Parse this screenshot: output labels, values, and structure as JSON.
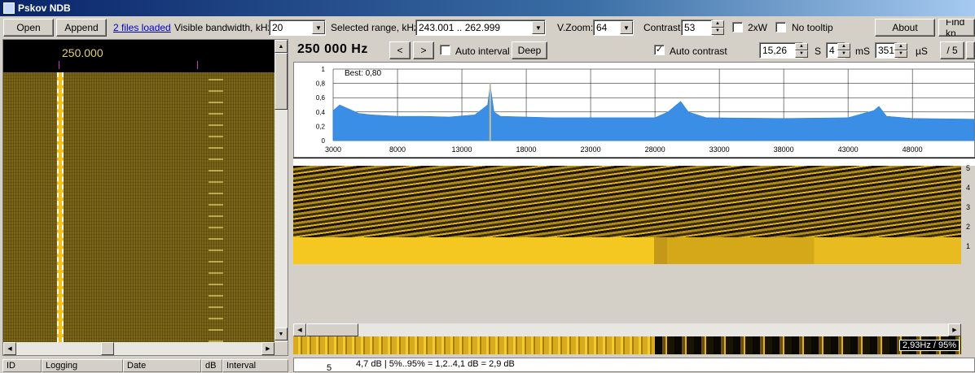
{
  "window": {
    "title": "Pskov NDB"
  },
  "toolbar": {
    "open_label": "Open",
    "append_label": "Append",
    "files_loaded": "2 files loaded",
    "visible_bw_label": "Visible bandwidth, kHz:",
    "visible_bw_value": "20",
    "selected_range_label": "Selected range, kHz:",
    "selected_range_value": "243.001 .. 262.999",
    "vzoom_label": "V.Zoom:",
    "vzoom_value": "64",
    "contrast_label": "Contrast:",
    "contrast_value": "53",
    "twoxw_label": "2xW",
    "no_tooltip_label": "No tooltip",
    "about_label": "About",
    "find_label": "Find kn"
  },
  "left_panel": {
    "center_freq": "250.000"
  },
  "table": {
    "columns": [
      "ID",
      "Logging",
      "Date",
      "dB",
      "Interval"
    ]
  },
  "right_panel": {
    "freq_display": "250 000 Hz",
    "prev_label": "<",
    "next_label": ">",
    "auto_interval_label": "Auto interval",
    "deep_label": "Deep",
    "auto_contrast_label": "Auto contrast",
    "auto_contrast_checked": true,
    "s_value": "15,26",
    "s_unit": "S",
    "ms_value": "4",
    "ms_unit": "mS",
    "us_value": "351",
    "us_unit": "µS",
    "div_label": "/ 5",
    "best_label": "Best: 0,80",
    "bw_info": "2,93Hz / 95%",
    "status_text": "4,7 dB | 5%..95% = 1,2..4,1 dB = 2,9 dB",
    "side_labels": [
      "5",
      "4",
      "3",
      "2",
      "1"
    ],
    "bottom_num": "5"
  },
  "chart_data": {
    "type": "area",
    "title": "Best: 0,80",
    "xlabel": "",
    "ylabel": "",
    "x_ticks": [
      3000,
      8000,
      13000,
      18000,
      23000,
      28000,
      33000,
      38000,
      43000,
      48000
    ],
    "y_ticks": [
      0,
      0.2,
      0.4,
      0.6,
      0.8,
      1
    ],
    "xlim": [
      3000,
      52800
    ],
    "ylim": [
      0,
      1
    ],
    "series": [
      {
        "values": [
          [
            3000,
            0.42
          ],
          [
            3500,
            0.5
          ],
          [
            4000,
            0.46
          ],
          [
            5000,
            0.38
          ],
          [
            6000,
            0.36
          ],
          [
            8000,
            0.34
          ],
          [
            10000,
            0.34
          ],
          [
            12000,
            0.33
          ],
          [
            14000,
            0.36
          ],
          [
            15000,
            0.5
          ],
          [
            15200,
            0.78
          ],
          [
            15500,
            0.4
          ],
          [
            16000,
            0.34
          ],
          [
            20000,
            0.32
          ],
          [
            25000,
            0.32
          ],
          [
            28000,
            0.32
          ],
          [
            29000,
            0.4
          ],
          [
            30000,
            0.55
          ],
          [
            30600,
            0.4
          ],
          [
            32000,
            0.32
          ],
          [
            38000,
            0.31
          ],
          [
            43000,
            0.32
          ],
          [
            45000,
            0.42
          ],
          [
            45400,
            0.48
          ],
          [
            46000,
            0.34
          ],
          [
            48000,
            0.31
          ],
          [
            52800,
            0.3
          ]
        ]
      }
    ],
    "grid": true,
    "marker_x": 15200
  }
}
